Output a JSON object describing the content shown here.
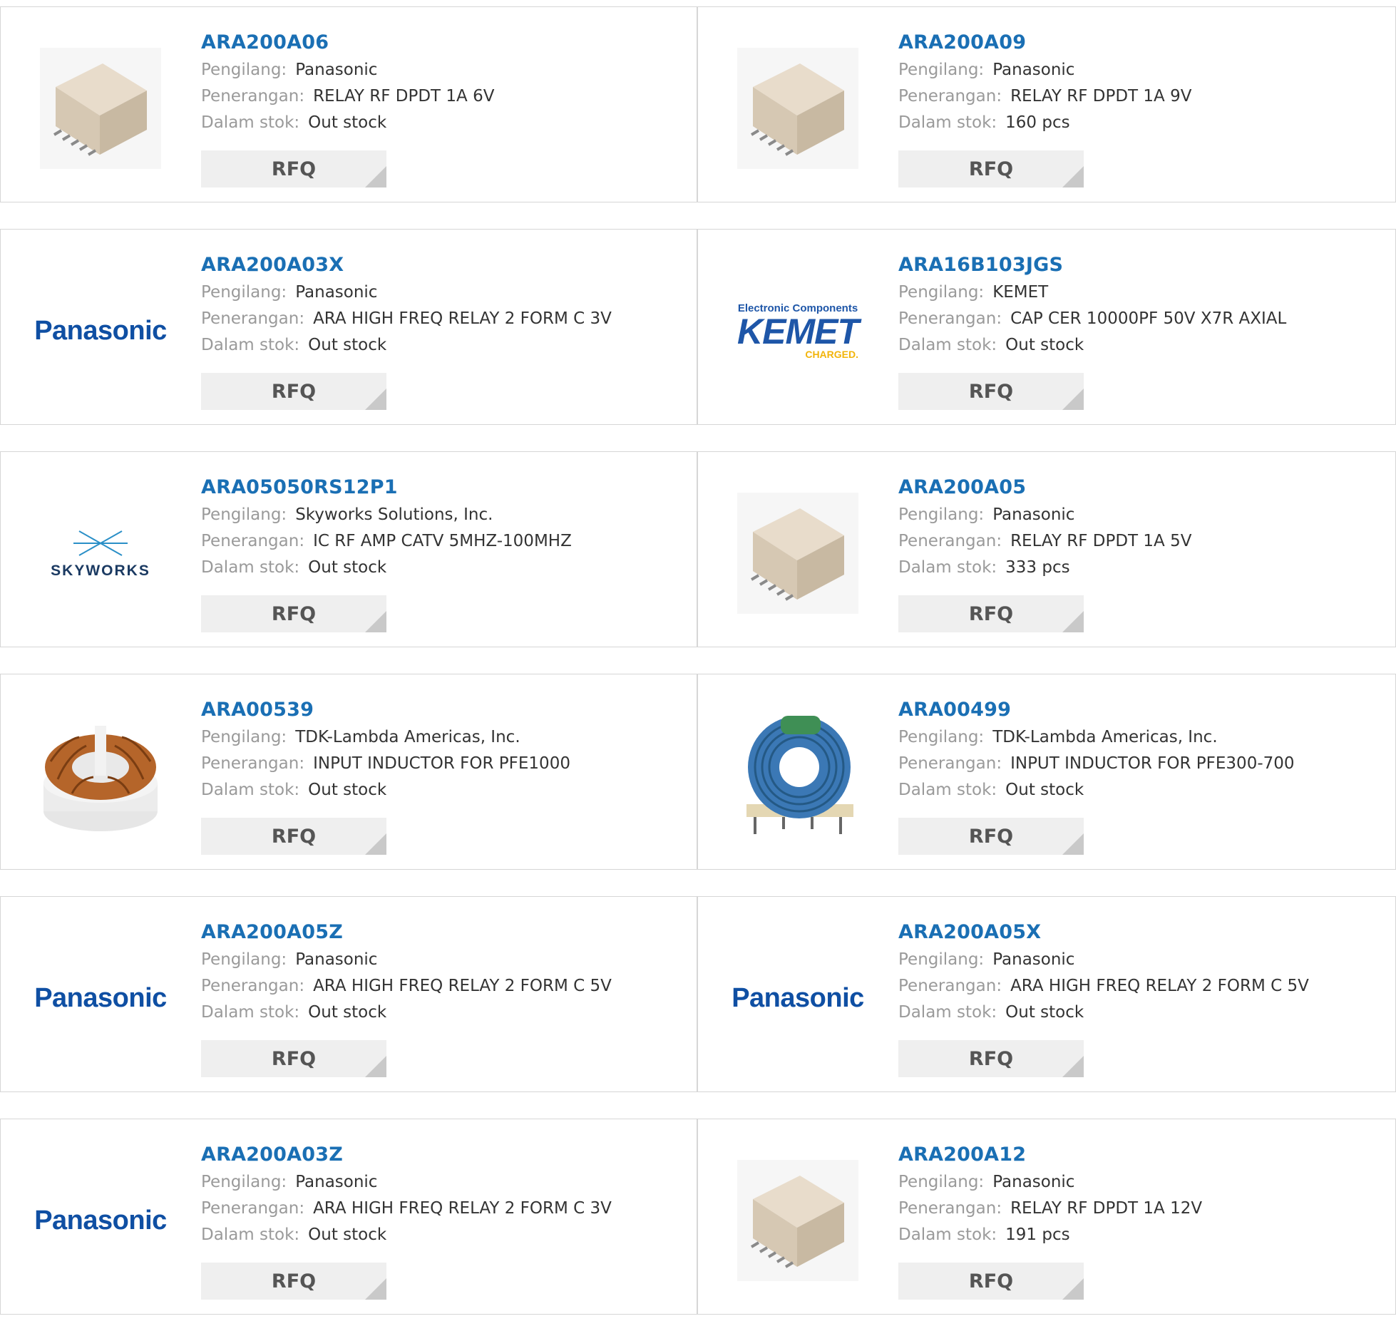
{
  "labels": {
    "manufacturer": "Pengilang:",
    "description": "Penerangan:",
    "stock": "Dalam stok:",
    "rfq": "RFQ"
  },
  "products": [
    {
      "part": "ARA200A06",
      "manufacturer": "Panasonic",
      "description": "RELAY RF DPDT 1A 6V",
      "stock": "Out stock",
      "image": "relay-icon"
    },
    {
      "part": "ARA200A09",
      "manufacturer": "Panasonic",
      "description": "RELAY RF DPDT 1A 9V",
      "stock": "160 pcs",
      "image": "relay-icon"
    },
    {
      "part": "ARA200A03X",
      "manufacturer": "Panasonic",
      "description": "ARA HIGH FREQ RELAY 2 FORM C 3V",
      "stock": "Out stock",
      "image": "panasonic-logo",
      "logo_text": "Panasonic"
    },
    {
      "part": "ARA16B103JGS",
      "manufacturer": "KEMET",
      "description": "CAP CER 10000PF 50V X7R AXIAL",
      "stock": "Out stock",
      "image": "kemet-logo",
      "logo_top": "Electronic Components",
      "logo_text": "KEMET",
      "logo_sub": "CHARGED."
    },
    {
      "part": "ARA05050RS12P1",
      "manufacturer": "Skyworks Solutions, Inc.",
      "description": "IC RF AMP CATV 5MHZ-100MHZ",
      "stock": "Out stock",
      "image": "skyworks-logo",
      "logo_text": "SKYWORKS"
    },
    {
      "part": "ARA200A05",
      "manufacturer": "Panasonic",
      "description": "RELAY RF DPDT 1A 5V",
      "stock": "333 pcs",
      "image": "relay-icon"
    },
    {
      "part": "ARA00539",
      "manufacturer": "TDK-Lambda Americas, Inc.",
      "description": "INPUT INDUCTOR FOR PFE1000",
      "stock": "Out stock",
      "image": "copper-toroid-icon"
    },
    {
      "part": "ARA00499",
      "manufacturer": "TDK-Lambda Americas, Inc.",
      "description": "INPUT INDUCTOR FOR PFE300-700",
      "stock": "Out stock",
      "image": "blue-toroid-icon"
    },
    {
      "part": "ARA200A05Z",
      "manufacturer": "Panasonic",
      "description": "ARA HIGH FREQ RELAY 2 FORM C 5V",
      "stock": "Out stock",
      "image": "panasonic-logo",
      "logo_text": "Panasonic"
    },
    {
      "part": "ARA200A05X",
      "manufacturer": "Panasonic",
      "description": "ARA HIGH FREQ RELAY 2 FORM C 5V",
      "stock": "Out stock",
      "image": "panasonic-logo",
      "logo_text": "Panasonic"
    },
    {
      "part": "ARA200A03Z",
      "manufacturer": "Panasonic",
      "description": "ARA HIGH FREQ RELAY 2 FORM C 3V",
      "stock": "Out stock",
      "image": "panasonic-logo",
      "logo_text": "Panasonic"
    },
    {
      "part": "ARA200A12",
      "manufacturer": "Panasonic",
      "description": "RELAY RF DPDT 1A 12V",
      "stock": "191 pcs",
      "image": "relay-icon"
    }
  ],
  "colors": {
    "link": "#1a6fb4",
    "label": "#9a9a9a",
    "value": "#333333",
    "button_bg": "#efefef",
    "border": "#d6d6d6"
  }
}
